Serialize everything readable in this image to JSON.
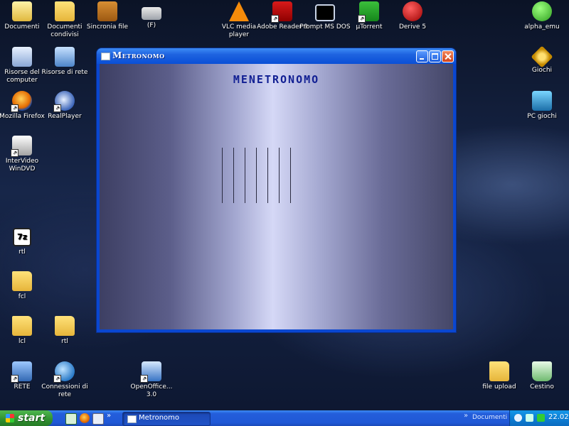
{
  "desktop": {
    "icons": [
      {
        "label": "Documenti",
        "icon": "folder-documents-icon"
      },
      {
        "label": "Documenti condivisi",
        "icon": "shared-folder-icon"
      },
      {
        "label": "Sincronia file",
        "icon": "briefcase-icon"
      },
      {
        "label": "(F)",
        "icon": "drive-icon"
      },
      {
        "label": "VLC media player",
        "icon": "vlc-icon"
      },
      {
        "label": "Adobe Reader 9",
        "icon": "adobe-reader-icon"
      },
      {
        "label": "Prompt MS DOS",
        "icon": "command-prompt-icon"
      },
      {
        "label": "µTorrent",
        "icon": "utorrent-icon"
      },
      {
        "label": "Derive 5",
        "icon": "derive-icon"
      },
      {
        "label": "alpha_emu",
        "icon": "alpha-emu-icon"
      },
      {
        "label": "Risorse del computer",
        "icon": "my-computer-icon"
      },
      {
        "label": "Risorse di rete",
        "icon": "network-places-icon"
      },
      {
        "label": "Giochi",
        "icon": "games-icon"
      },
      {
        "label": "Mozilla Firefox",
        "icon": "firefox-icon"
      },
      {
        "label": "RealPlayer",
        "icon": "realplayer-icon"
      },
      {
        "label": "PC giochi",
        "icon": "pc-games-icon"
      },
      {
        "label": "InterVideo WinDVD",
        "icon": "windvd-icon"
      },
      {
        "label": "rtl",
        "icon": "7zip-icon"
      },
      {
        "label": "fcl",
        "icon": "folder-icon"
      },
      {
        "label": "lcl",
        "icon": "folder-icon"
      },
      {
        "label": "rtl",
        "icon": "folder-icon"
      },
      {
        "label": "RETE",
        "icon": "network-icon"
      },
      {
        "label": "Connessioni di rete",
        "icon": "network-connections-icon"
      },
      {
        "label": "OpenOffice... 3.0",
        "icon": "openoffice-icon"
      },
      {
        "label": "file upload",
        "icon": "folder-icon"
      },
      {
        "label": "Cestino",
        "icon": "recycle-bin-icon"
      }
    ]
  },
  "window": {
    "title": "Metronomo",
    "heading": "MENETRONOMO",
    "colors": {
      "heading": "#111f93",
      "client_center": "#d5d8f6",
      "client_edge": "#3d3f63"
    }
  },
  "taskbar": {
    "start_label": "start",
    "task_label": "Metronomo",
    "tray_toolbar_label": "Documenti",
    "clock": "22.02"
  }
}
